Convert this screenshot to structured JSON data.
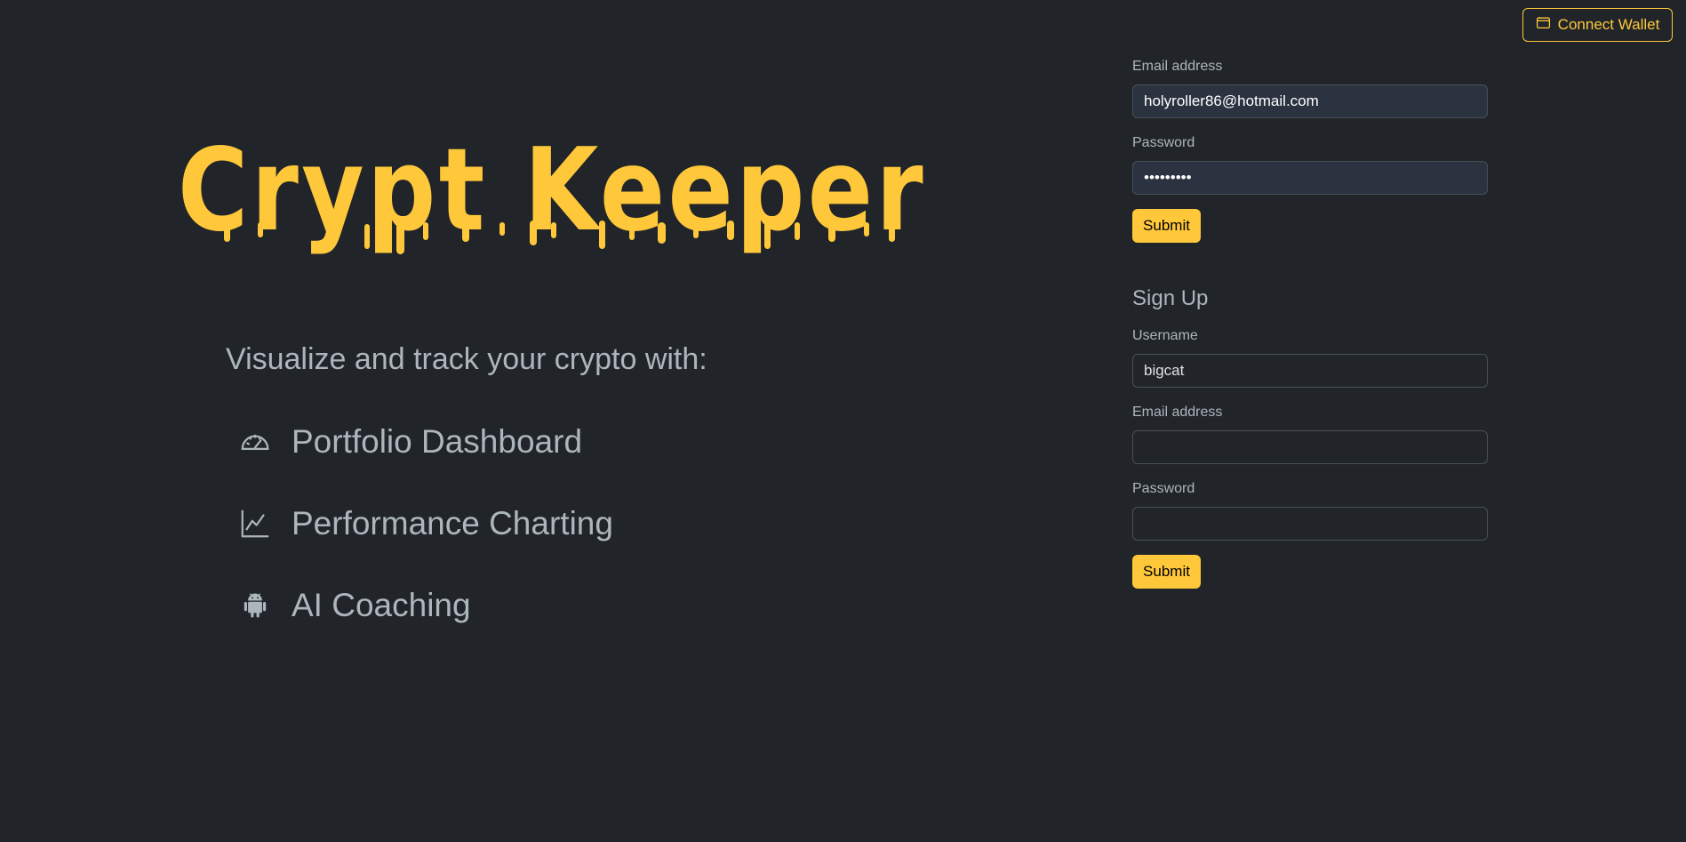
{
  "header": {
    "connect_wallet_label": "Connect Wallet"
  },
  "hero": {
    "logo_text": "Crypt Keeper",
    "tagline": "Visualize and track your crypto with:",
    "features": [
      {
        "label": "Portfolio Dashboard",
        "icon": "speedometer-icon"
      },
      {
        "label": "Performance Charting",
        "icon": "line-chart-icon"
      },
      {
        "label": "AI Coaching",
        "icon": "android-icon"
      }
    ]
  },
  "login": {
    "email_label": "Email address",
    "email_value": "holyroller86@hotmail.com",
    "password_label": "Password",
    "password_value": "•••••••••",
    "submit_label": "Submit"
  },
  "signup": {
    "title": "Sign Up",
    "username_label": "Username",
    "username_value": "bigcat",
    "email_label": "Email address",
    "email_value": "",
    "password_label": "Password",
    "password_value": "",
    "submit_label": "Submit"
  },
  "colors": {
    "background": "#212529",
    "accent": "#ffc83b",
    "text_muted": "#adb5bd"
  }
}
